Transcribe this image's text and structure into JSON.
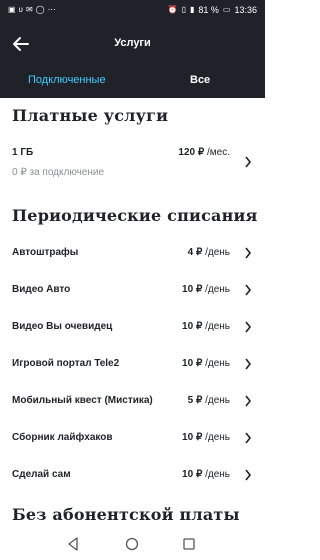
{
  "status_bar": {
    "battery": "81 %",
    "time": "13:36",
    "icons": [
      "notification-icon",
      "vk-icon",
      "mail-icon",
      "whatsapp-icon",
      "dots-icon",
      "alarm-icon",
      "vibrate-icon",
      "signal-icon",
      "battery-icon"
    ]
  },
  "header": {
    "title": "Услуги",
    "back_icon": "arrow-left-icon"
  },
  "tabs": [
    {
      "label": "Подключенные",
      "active": true
    },
    {
      "label": "Все",
      "active": false
    }
  ],
  "paid": {
    "title": "Платные услуги",
    "item": {
      "name": "1 ГБ",
      "amount": "120 ₽",
      "unit": " /мес.",
      "note": "0 ₽ за подключение"
    }
  },
  "periodic": {
    "title": "Периодические списания",
    "items": [
      {
        "name": "Автоштрафы",
        "amount": "4 ₽",
        "unit": " /день"
      },
      {
        "name": "Видео Авто",
        "amount": "10 ₽",
        "unit": " /день"
      },
      {
        "name": "Видео Вы очевидец",
        "amount": "10 ₽",
        "unit": " /день"
      },
      {
        "name": "Игровой портал Tele2",
        "amount": "10 ₽",
        "unit": " /день"
      },
      {
        "name": "Мобильный квест (Мистика)",
        "amount": "5 ₽",
        "unit": " /день"
      },
      {
        "name": "Сборник лайфхаков",
        "amount": "10 ₽",
        "unit": " /день"
      },
      {
        "name": "Сделай сам",
        "amount": "10 ₽",
        "unit": " /день"
      }
    ]
  },
  "free": {
    "title": "Без абонентской платы"
  },
  "colors": {
    "header_bg": "#1f2229",
    "accent": "#3fcbff"
  }
}
